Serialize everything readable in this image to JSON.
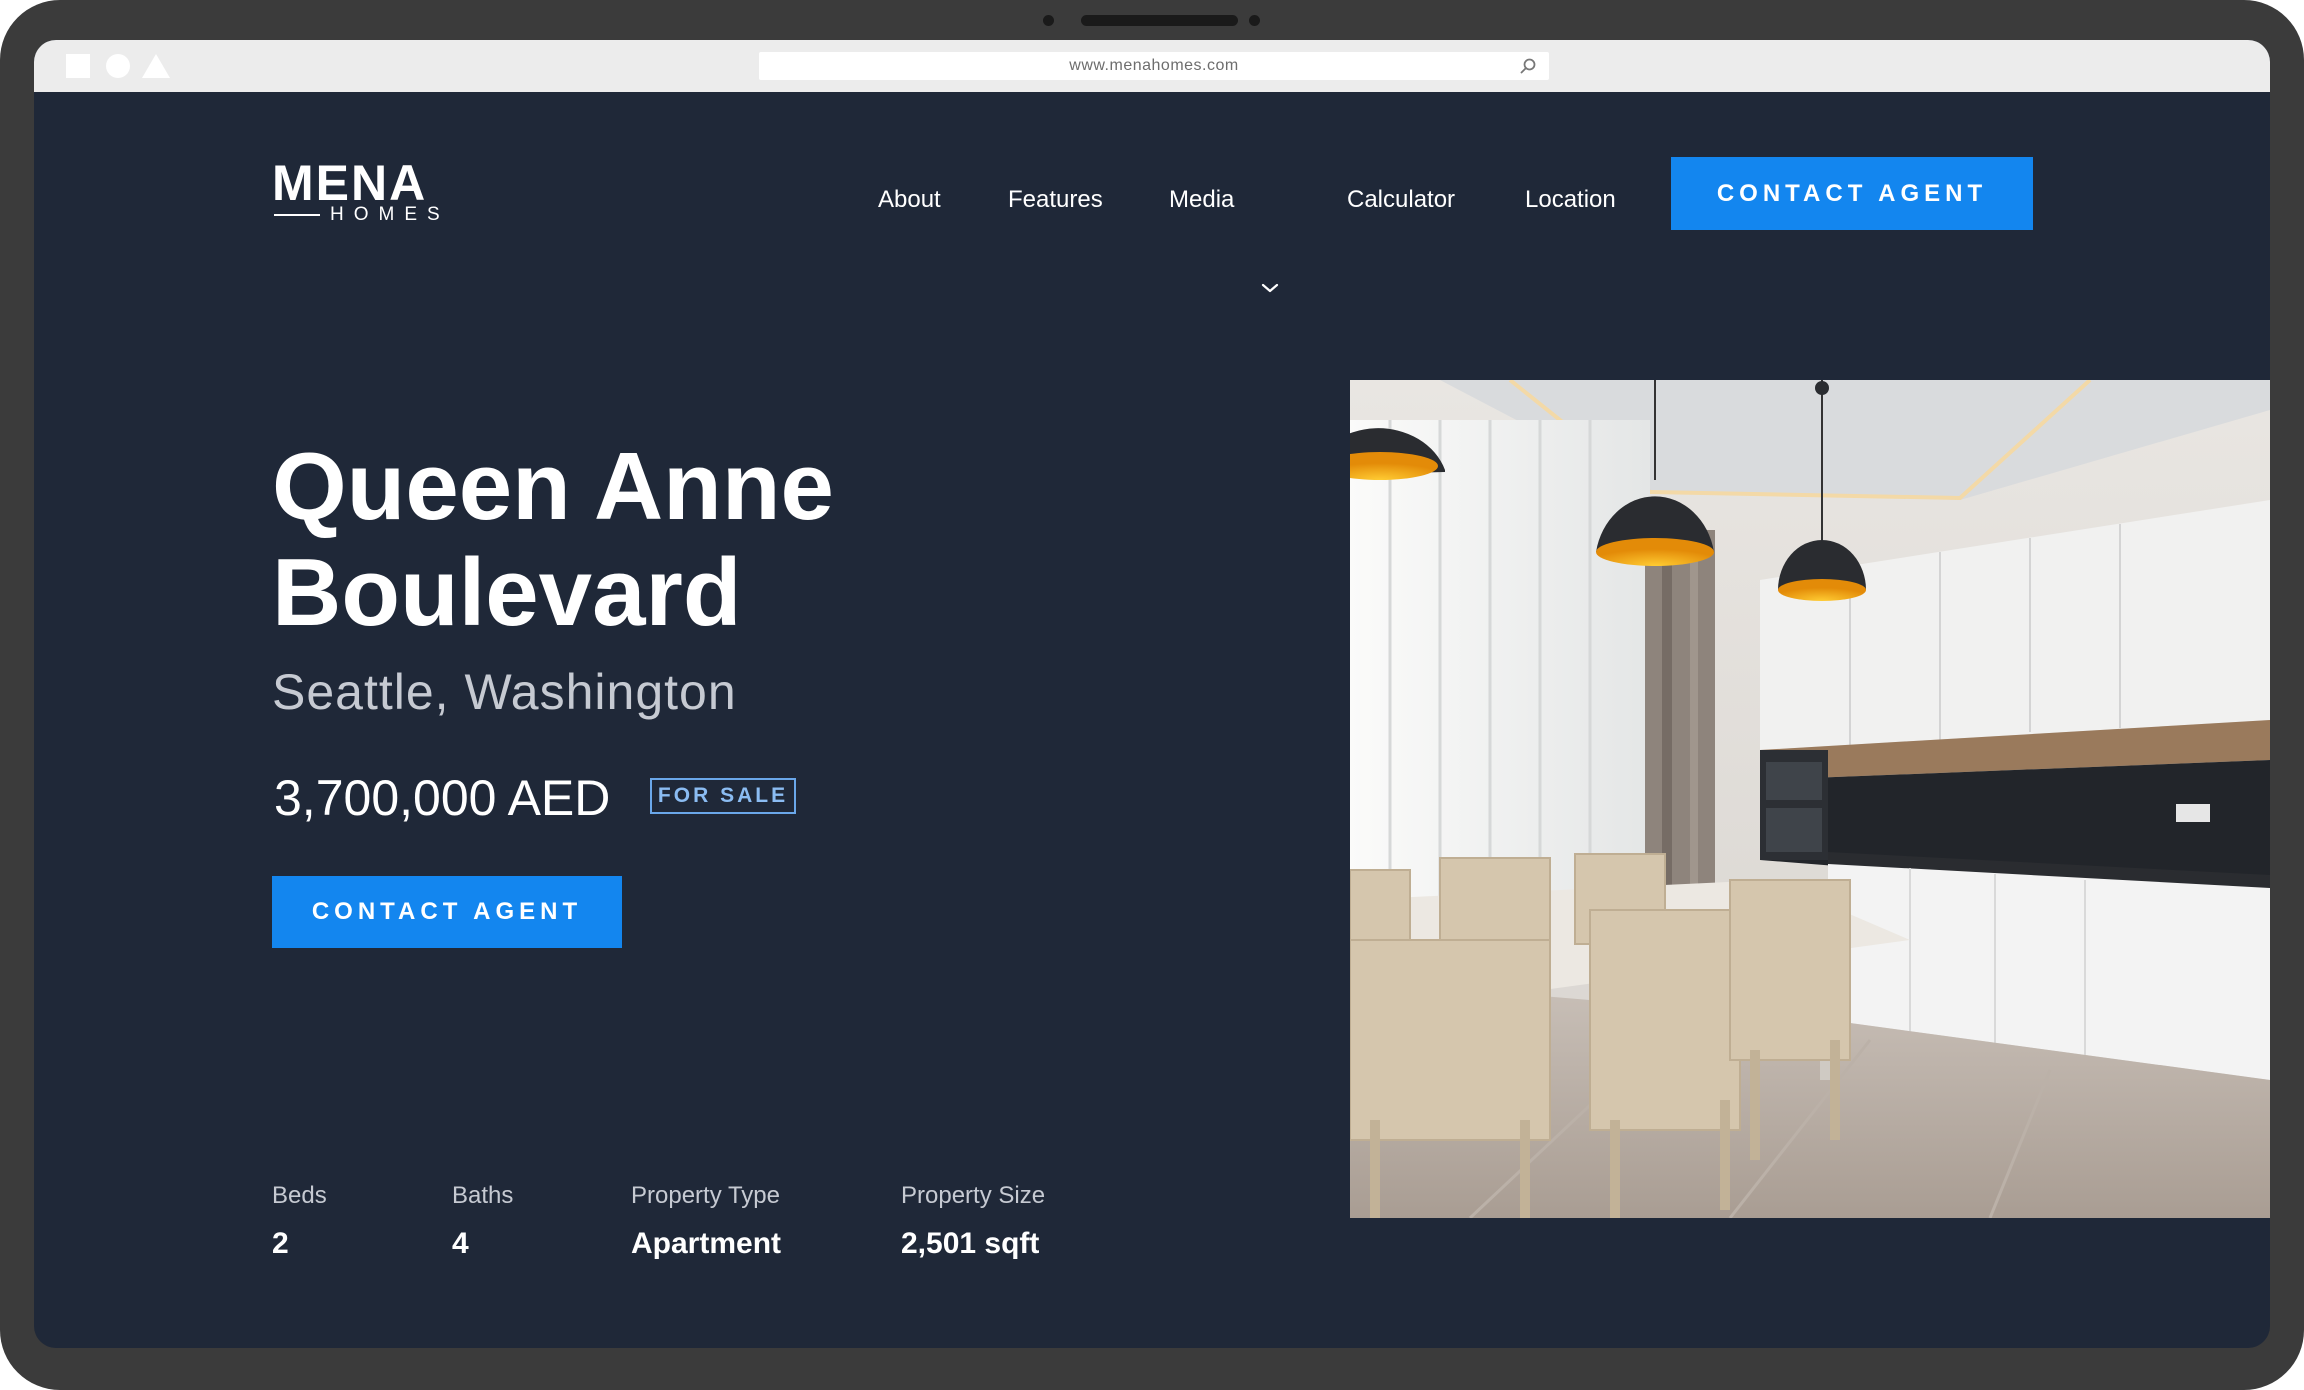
{
  "browser": {
    "url": "www.menahomes.com",
    "icons": [
      "square-icon",
      "circle-icon",
      "triangle-icon",
      "search-icon"
    ]
  },
  "logo": {
    "main": "MENA",
    "sub": "HOMES"
  },
  "nav": {
    "items": [
      {
        "label": "About"
      },
      {
        "label": "Features"
      },
      {
        "label": "Media",
        "has_dropdown": true
      },
      {
        "label": "Calculator"
      },
      {
        "label": "Location"
      }
    ],
    "cta_label": "CONTACT AGENT"
  },
  "hero": {
    "title_line1": "Queen Anne",
    "title_line2": "Boulevard",
    "location": "Seattle, Washington",
    "price": "3,700,000 AED",
    "badge": "FOR SALE",
    "cta_label": "CONTACT AGENT"
  },
  "stats": [
    {
      "label": "Beds",
      "value": "2"
    },
    {
      "label": "Baths",
      "value": "4"
    },
    {
      "label": "Property Type",
      "value": "Apartment"
    },
    {
      "label": "Property Size",
      "value": "2,501 sqft"
    }
  ],
  "colors": {
    "background": "#1f2838",
    "accent": "#1386ef",
    "badge_border": "#6aa7ea",
    "muted_text": "#c6cad2"
  }
}
